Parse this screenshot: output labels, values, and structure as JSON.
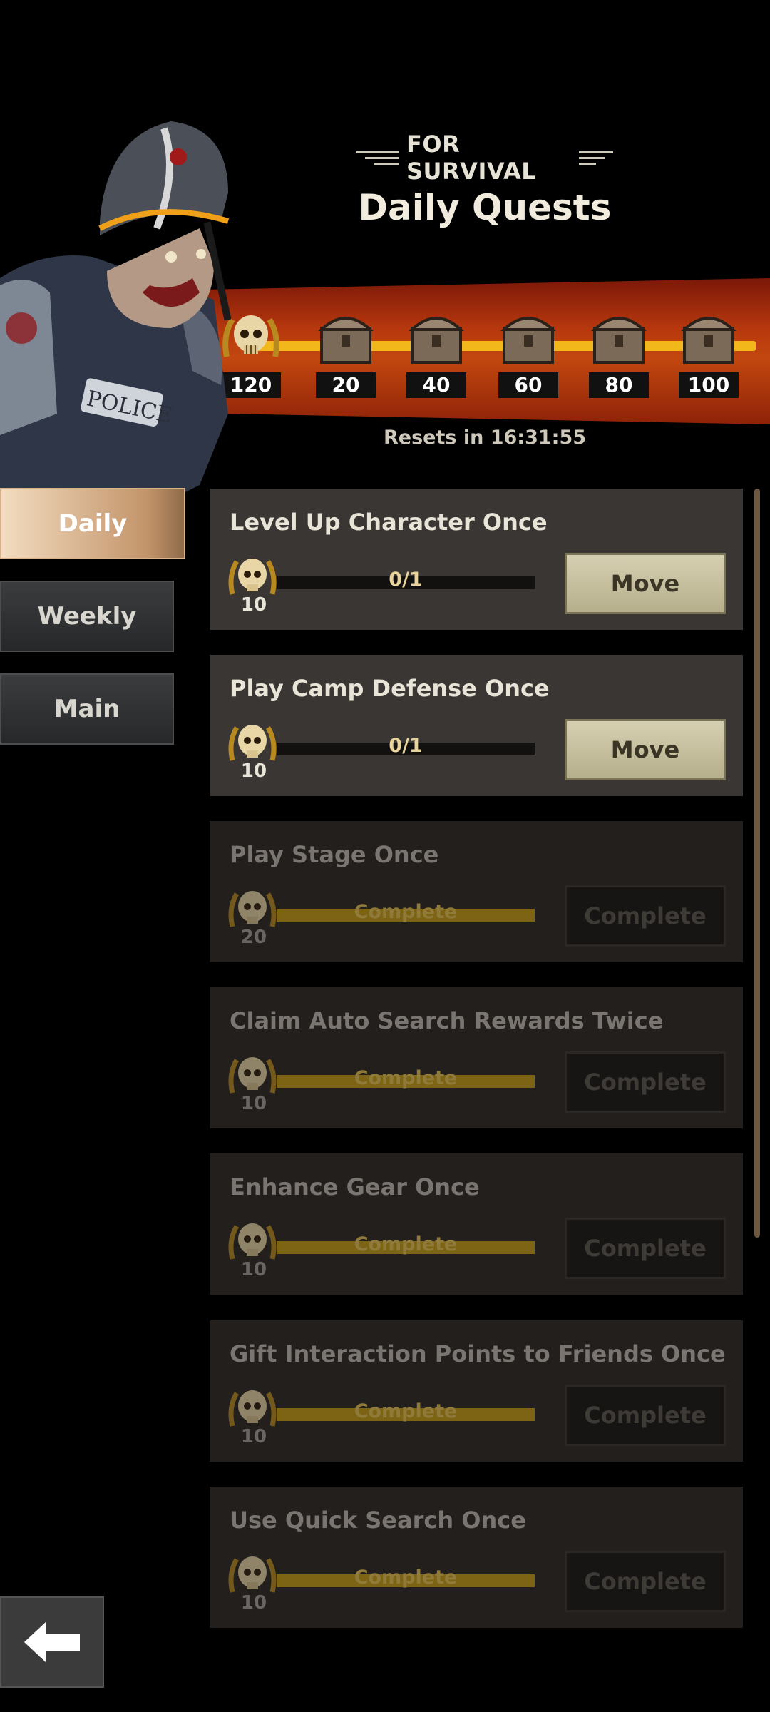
{
  "header": {
    "eyebrow": "FOR SURVIVAL",
    "title": "Daily Quests"
  },
  "character": {
    "badge_text": "POLICE"
  },
  "rewards": {
    "points": "120",
    "milestones": [
      "20",
      "40",
      "60",
      "80",
      "100"
    ],
    "reset_text": "Resets in 16:31:55",
    "colors": {
      "banner": "#b8380e",
      "track": "#f2b71a"
    }
  },
  "tabs": [
    {
      "label": "Daily",
      "active": true
    },
    {
      "label": "Weekly",
      "active": false
    },
    {
      "label": "Main",
      "active": false
    }
  ],
  "quests": [
    {
      "title": "Level Up Character Once",
      "reward": "10",
      "progress_text": "0/1",
      "progress": 0,
      "button": "Move",
      "done": false
    },
    {
      "title": "Play Camp Defense Once",
      "reward": "10",
      "progress_text": "0/1",
      "progress": 0,
      "button": "Move",
      "done": false
    },
    {
      "title": "Play Stage Once",
      "reward": "20",
      "progress_text": "Complete",
      "progress": 1,
      "button": "Complete",
      "done": true
    },
    {
      "title": "Claim Auto Search Rewards Twice",
      "reward": "10",
      "progress_text": "Complete",
      "progress": 1,
      "button": "Complete",
      "done": true
    },
    {
      "title": "Enhance Gear Once",
      "reward": "10",
      "progress_text": "Complete",
      "progress": 1,
      "button": "Complete",
      "done": true
    },
    {
      "title": "Gift Interaction Points to Friends Once",
      "reward": "10",
      "progress_text": "Complete",
      "progress": 1,
      "button": "Complete",
      "done": true
    },
    {
      "title": "Use Quick Search Once",
      "reward": "10",
      "progress_text": "Complete",
      "progress": 1,
      "button": "Complete",
      "done": true
    }
  ],
  "icons": {
    "back": "arrow-left-icon",
    "reward": "skull-laurel-icon",
    "milestone": "chest-icon"
  }
}
